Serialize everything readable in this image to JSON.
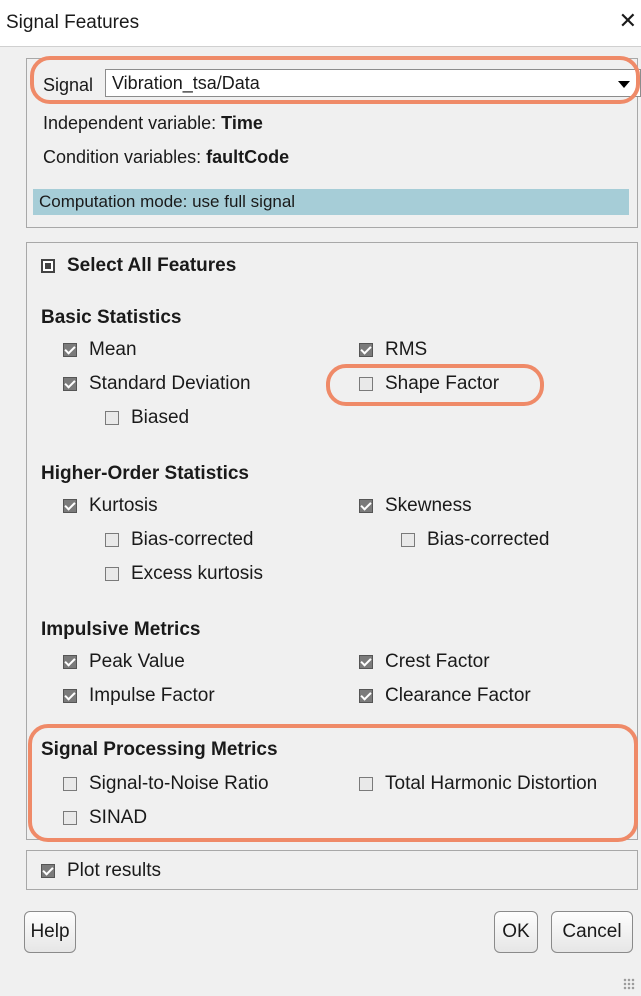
{
  "window": {
    "title": "Signal Features",
    "close_glyph": "✕"
  },
  "signal": {
    "label": "Signal",
    "value": "Vibration_tsa/Data",
    "independent_label": "Independent variable:",
    "independent_value": "Time",
    "condition_label": "Condition variables:",
    "condition_value": "faultCode",
    "computation_mode": "Computation mode: use full signal"
  },
  "features": {
    "select_all": "Select All Features",
    "basic": {
      "title": "Basic Statistics",
      "mean": "Mean",
      "rms": "RMS",
      "std": "Standard Deviation",
      "shape": "Shape Factor",
      "biased": "Biased"
    },
    "higher": {
      "title": "Higher-Order Statistics",
      "kurtosis": "Kurtosis",
      "skewness": "Skewness",
      "kurt_bias": "Bias-corrected",
      "skew_bias": "Bias-corrected",
      "excess": "Excess kurtosis"
    },
    "impulsive": {
      "title": "Impulsive Metrics",
      "peak": "Peak Value",
      "crest": "Crest Factor",
      "impulse": "Impulse Factor",
      "clearance": "Clearance Factor"
    },
    "signal_processing": {
      "title": "Signal Processing Metrics",
      "snr": "Signal-to-Noise Ratio",
      "thd": "Total Harmonic Distortion",
      "sinad": "SINAD"
    }
  },
  "plot_results": "Plot results",
  "buttons": {
    "help": "Help",
    "ok": "OK",
    "cancel": "Cancel"
  },
  "colors": {
    "highlight": "#ef8a68",
    "computation_bar": "#a6cdd7"
  }
}
